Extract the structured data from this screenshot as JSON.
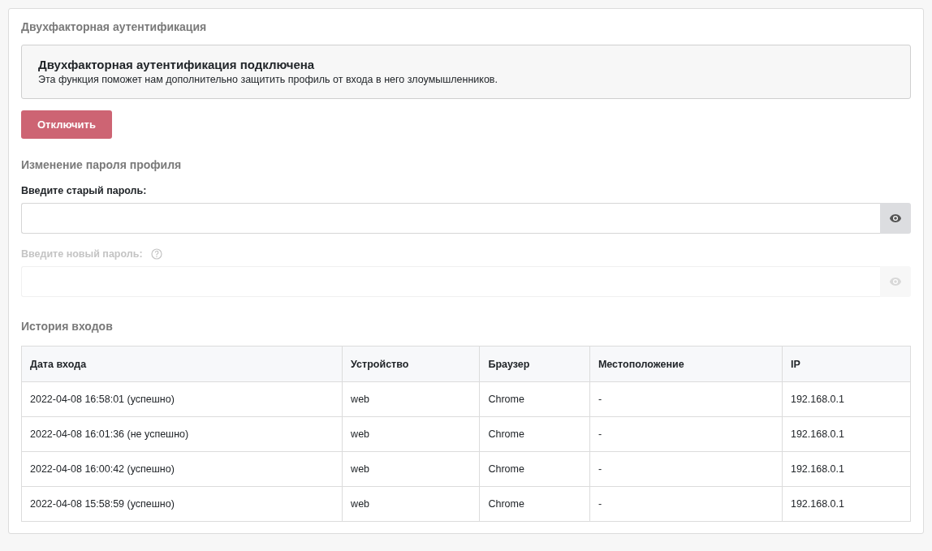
{
  "two_factor": {
    "heading": "Двухфакторная аутентификация",
    "notice_title": "Двухфакторная аутентификация подключена",
    "notice_text": "Эта функция поможет нам дополнительно защитить профиль от входа в него злоумышленников.",
    "button": "Отключить"
  },
  "password": {
    "heading": "Изменение пароля профиля",
    "fields": [
      {
        "label": "Введите старый пароль:",
        "disabled": false,
        "help": false
      },
      {
        "label": "Введите новый пароль:",
        "disabled": true,
        "help": true
      }
    ]
  },
  "history": {
    "heading": "История входов",
    "columns": [
      "Дата входа",
      "Устройство",
      "Браузер",
      "Местоположение",
      "IP"
    ],
    "rows": [
      [
        "2022-04-08 16:58:01 (успешно)",
        "web",
        "Chrome",
        "-",
        "192.168.0.1"
      ],
      [
        "2022-04-08 16:01:36 (не успешно)",
        "web",
        "Chrome",
        "-",
        "192.168.0.1"
      ],
      [
        "2022-04-08 16:00:42 (успешно)",
        "web",
        "Chrome",
        "-",
        "192.168.0.1"
      ],
      [
        "2022-04-08 15:58:59 (успешно)",
        "web",
        "Chrome",
        "-",
        "192.168.0.1"
      ]
    ]
  }
}
